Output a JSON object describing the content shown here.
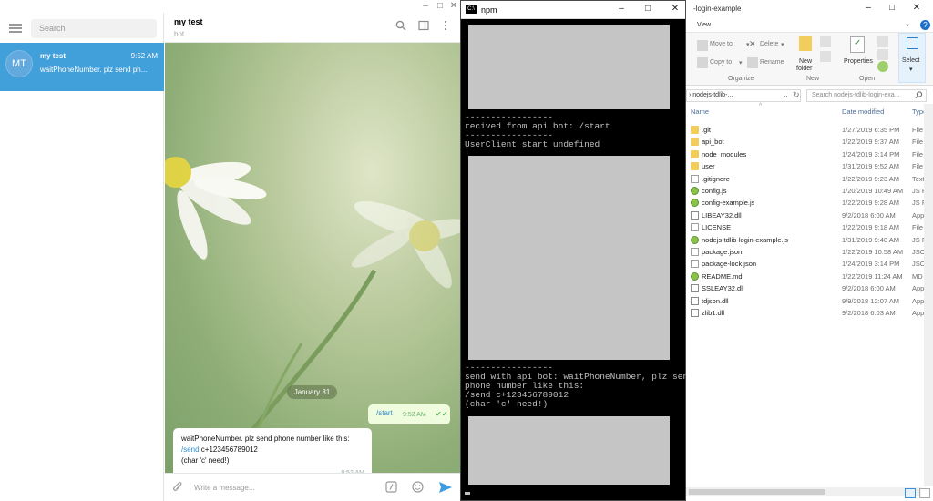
{
  "telegram": {
    "titlebar_min": "‒",
    "titlebar_max": "□",
    "titlebar_close": "✕",
    "search_placeholder": "Search",
    "chat": {
      "avatar": "MT",
      "name": "my test",
      "time": "9:52 AM",
      "preview": "waitPhoneNumber. plz send ph..."
    },
    "header": {
      "title": "my test",
      "subtitle": "bot"
    },
    "date_pill": "January 31",
    "outgoing": {
      "text": "/start",
      "time": "9:52 AM"
    },
    "incoming": {
      "line1": "waitPhoneNumber. plz send phone number like this:",
      "cmd": "/send",
      "line2_rest": " c+123456789012",
      "line3": "(char 'c' need!)",
      "time": "9:52 AM"
    },
    "compose_placeholder": "Write a message...",
    "accent": "#419fd9"
  },
  "npm": {
    "title": "npm",
    "lines_a": "-----------------\nrecived from api bot: /start\n-----------------\nUserClient start undefined",
    "lines_b": "-----------------\nsend with api bot: waitPhoneNumber, plz send\nphone number like this:\n/send c+123456789012\n(char 'c' need!)"
  },
  "explorer": {
    "title": "-login-example",
    "menu_view": "View",
    "ribbon": {
      "move_to": "Move to",
      "copy_to": "Copy to",
      "delete": "Delete",
      "rename": "Rename",
      "new_folder_1": "New",
      "new_folder_2": "folder",
      "properties": "Properties",
      "select": "Select",
      "group_organize": "Organize",
      "group_new": "New",
      "group_open": "Open"
    },
    "address": "› nodejs-tdlib-...",
    "search_placeholder": "Search nodejs-tdlib-login-exa...",
    "columns": {
      "name": "Name",
      "date": "Date modified",
      "type": "Type"
    },
    "files": [
      {
        "name": ".git",
        "date": "1/27/2019 6:35 PM",
        "type": "File fol",
        "kind": "folder"
      },
      {
        "name": "api_bot",
        "date": "1/22/2019 9:37 AM",
        "type": "File fol",
        "kind": "folder"
      },
      {
        "name": "node_modules",
        "date": "1/24/2019 3:14 PM",
        "type": "File fol",
        "kind": "folder"
      },
      {
        "name": "user",
        "date": "1/31/2019 9:52 AM",
        "type": "File fol",
        "kind": "folder"
      },
      {
        "name": ".gitignore",
        "date": "1/22/2019 9:23 AM",
        "type": "Text Do",
        "kind": "doc"
      },
      {
        "name": "config.js",
        "date": "1/20/2019 10:49 AM",
        "type": "JS File",
        "kind": "js"
      },
      {
        "name": "config-example.js",
        "date": "1/22/2019 9:28 AM",
        "type": "JS File",
        "kind": "js"
      },
      {
        "name": "LIBEAY32.dll",
        "date": "9/2/2018 6:00 AM",
        "type": "Applic",
        "kind": "dll"
      },
      {
        "name": "LICENSE",
        "date": "1/22/2019 9:18 AM",
        "type": "File",
        "kind": "doc"
      },
      {
        "name": "nodejs-tdlib-login-example.js",
        "date": "1/31/2019 9:40 AM",
        "type": "JS File",
        "kind": "js"
      },
      {
        "name": "package.json",
        "date": "1/22/2019 10:58 AM",
        "type": "JSON F",
        "kind": "doc"
      },
      {
        "name": "package-lock.json",
        "date": "1/24/2019 3:14 PM",
        "type": "JSON F",
        "kind": "doc"
      },
      {
        "name": "README.md",
        "date": "1/22/2019 11:24 AM",
        "type": "MD File",
        "kind": "js"
      },
      {
        "name": "SSLEAY32.dll",
        "date": "9/2/2018 6:00 AM",
        "type": "Applic",
        "kind": "dll"
      },
      {
        "name": "tdjson.dll",
        "date": "9/9/2018 12:07 AM",
        "type": "Applic",
        "kind": "dll"
      },
      {
        "name": "zlib1.dll",
        "date": "9/2/2018 6:03 AM",
        "type": "Applic",
        "kind": "dll"
      }
    ]
  }
}
